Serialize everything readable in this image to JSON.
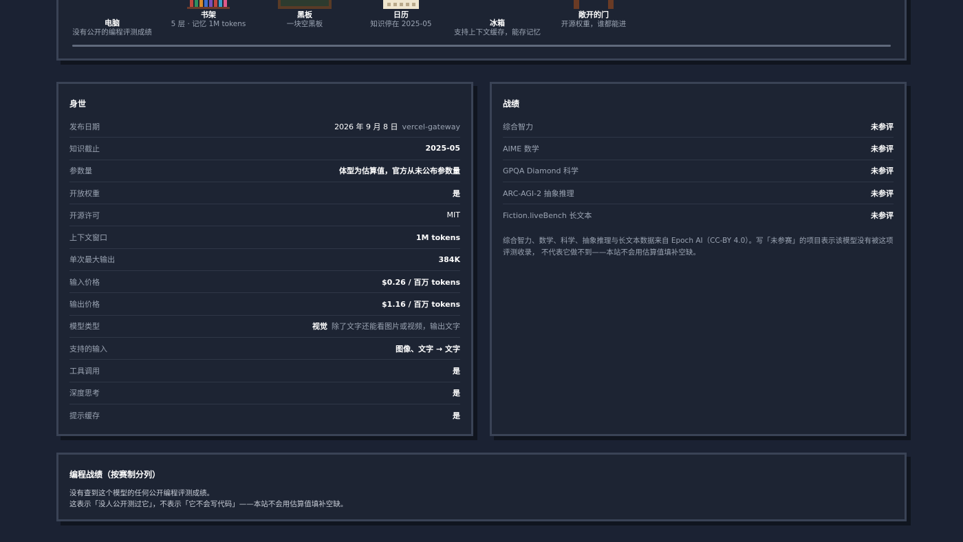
{
  "room": {
    "items": [
      {
        "name": "电脑",
        "desc": "没有公开的编程评测成绩",
        "icon": "computer-icon"
      },
      {
        "name": "书架",
        "desc": "5 层 · 记忆 1M tokens",
        "icon": "bookshelf-icon"
      },
      {
        "name": "黑板",
        "desc": "一块空黑板",
        "icon": "blackboard-icon"
      },
      {
        "name": "日历",
        "desc": "知识停在 2025-05",
        "icon": "calendar-icon"
      },
      {
        "name": "冰箱",
        "desc": "支持上下文缓存，能存记忆",
        "icon": "fridge-icon"
      },
      {
        "name": "敞开的门",
        "desc": "开源权重，谁都能进",
        "icon": "open-door-icon"
      }
    ],
    "book_colors": [
      "#c0463e",
      "#2f8f5f",
      "#d98a2b",
      "#3c6fd1",
      "#7b4fb8",
      "#c0463e",
      "#3aa0c9",
      "#e05a8a"
    ]
  },
  "identity": {
    "title": "身世",
    "rows": [
      {
        "key": "发布日期",
        "value": "2026 年 9 月 8 日",
        "sub": "vercel-gateway",
        "plain": true
      },
      {
        "key": "知识截止",
        "value": "2025-05"
      },
      {
        "key": "参数量",
        "value": "体型为估算值，官方从未公布参数量"
      },
      {
        "key": "开放权重",
        "value": "是"
      },
      {
        "key": "开源许可",
        "value": "MIT",
        "plain": true
      },
      {
        "key": "上下文窗口",
        "value": "1M tokens"
      },
      {
        "key": "单次最大输出",
        "value": "384K"
      },
      {
        "key": "输入价格",
        "value": "$0.26 / 百万 tokens"
      },
      {
        "key": "输出价格",
        "value": "$1.16 / 百万 tokens"
      },
      {
        "key": "模型类型",
        "value": "视觉",
        "sub": "除了文字还能看图片或视频，输出文字"
      },
      {
        "key": "支持的输入",
        "value": "图像、文字 → 文字"
      },
      {
        "key": "工具调用",
        "value": "是"
      },
      {
        "key": "深度思考",
        "value": "是"
      },
      {
        "key": "提示缓存",
        "value": "是"
      }
    ]
  },
  "record": {
    "title": "战绩",
    "rows": [
      {
        "key": "综合智力",
        "value": "未参评"
      },
      {
        "key": "AIME 数学",
        "value": "未参评"
      },
      {
        "key": "GPQA Diamond 科学",
        "value": "未参评"
      },
      {
        "key": "ARC-AGI-2 抽象推理",
        "value": "未参评"
      },
      {
        "key": "Fiction.liveBench 长文本",
        "value": "未参评"
      }
    ],
    "note": "综合智力、数学、科学、抽象推理与长文本数据来自 Epoch AI（CC-BY 4.0）。写「未参赛」的项目表示该模型没有被这项评测收录， 不代表它做不到——本站不会用估算值填补空缺。"
  },
  "coding": {
    "title": "编程战绩（按赛制分列）",
    "line1": "没有查到这个模型的任何公开编程评测成绩。",
    "line2": "这表示「没人公开测过它」，不表示「它不会写代码」——本站不会用估算值填补空缺。"
  }
}
